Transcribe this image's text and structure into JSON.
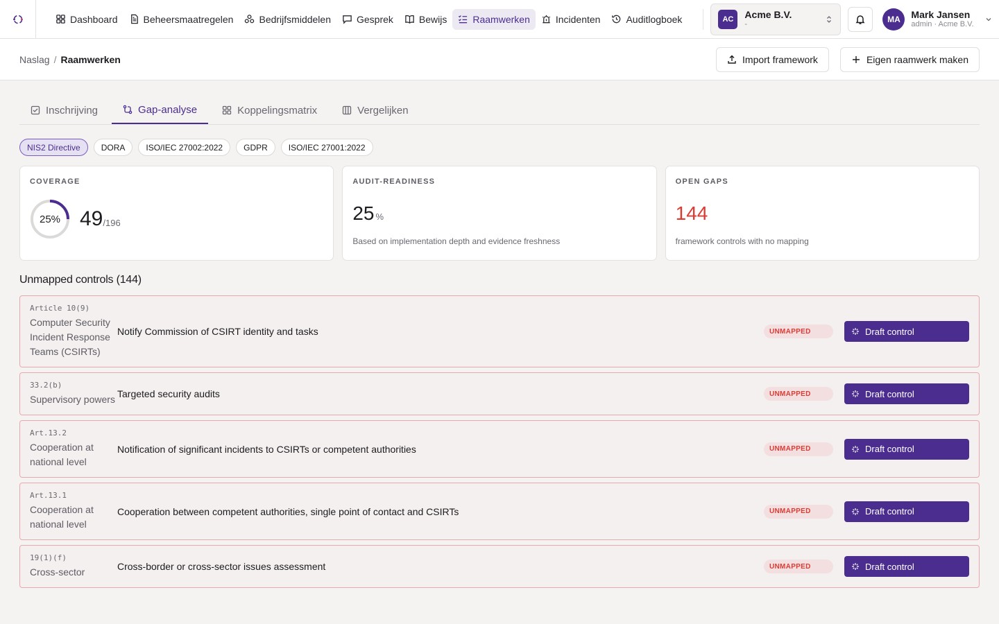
{
  "nav": {
    "items": [
      {
        "label": "Dashboard",
        "icon": "dashboard-icon",
        "active": false
      },
      {
        "label": "Beheersmaatregelen",
        "icon": "document-icon",
        "active": false
      },
      {
        "label": "Bedrijfsmiddelen",
        "icon": "assets-icon",
        "active": false
      },
      {
        "label": "Gesprek",
        "icon": "chat-icon",
        "active": false
      },
      {
        "label": "Bewijs",
        "icon": "book-icon",
        "active": false
      },
      {
        "label": "Raamwerken",
        "icon": "checklist-icon",
        "active": true
      },
      {
        "label": "Incidenten",
        "icon": "siren-icon",
        "active": false
      },
      {
        "label": "Auditlogboek",
        "icon": "history-icon",
        "active": false
      }
    ]
  },
  "org": {
    "badge": "AC",
    "name": "Acme B.V.",
    "sub": "-"
  },
  "user": {
    "initials": "MA",
    "name": "Mark Jansen",
    "role": "admin · Acme B.V."
  },
  "breadcrumb": {
    "parent": "Naslag",
    "separator": "/",
    "current": "Raamwerken"
  },
  "actions": {
    "import": "Import framework",
    "create": "Eigen raamwerk maken"
  },
  "tabs": [
    {
      "label": "Inschrijving",
      "active": false
    },
    {
      "label": "Gap-analyse",
      "active": true
    },
    {
      "label": "Koppelingsmatrix",
      "active": false
    },
    {
      "label": "Vergelijken",
      "active": false
    }
  ],
  "frameworks": [
    {
      "label": "NIS2 Directive",
      "active": true
    },
    {
      "label": "DORA",
      "active": false
    },
    {
      "label": "ISO/IEC 27002:2022",
      "active": false
    },
    {
      "label": "GDPR",
      "active": false
    },
    {
      "label": "ISO/IEC 27001:2022",
      "active": false
    }
  ],
  "coverage": {
    "label": "COVERAGE",
    "percent_text": "25%",
    "percent": 25,
    "mapped": "49",
    "total": "/196"
  },
  "readiness": {
    "label": "AUDIT-READINESS",
    "value": "25",
    "unit": "%",
    "note": "Based on implementation depth and evidence freshness"
  },
  "gaps": {
    "label": "OPEN GAPS",
    "value": "144",
    "note": "framework controls with no mapping"
  },
  "colors": {
    "accent": "#4b2d8f",
    "danger": "#dc3b33",
    "row_border": "#e8a8ad"
  },
  "unmapped": {
    "title": "Unmapped controls (144)",
    "status_label": "UNMAPPED",
    "action_label": "Draft control",
    "rows": [
      {
        "ref": "Article 10(9)",
        "area": "Computer Security Incident Response Teams (CSIRTs)",
        "title": "Notify Commission of CSIRT identity and tasks"
      },
      {
        "ref": "33.2(b)",
        "area": "Supervisory powers",
        "title": "Targeted security audits"
      },
      {
        "ref": "Art.13.2",
        "area": "Cooperation at national level",
        "title": "Notification of significant incidents to CSIRTs or competent authorities"
      },
      {
        "ref": "Art.13.1",
        "area": "Cooperation at national level",
        "title": "Cooperation between competent authorities, single point of contact and CSIRTs"
      },
      {
        "ref": "19(1)(f)",
        "area": "Cross-sector",
        "title": "Cross-border or cross-sector issues assessment"
      }
    ]
  }
}
